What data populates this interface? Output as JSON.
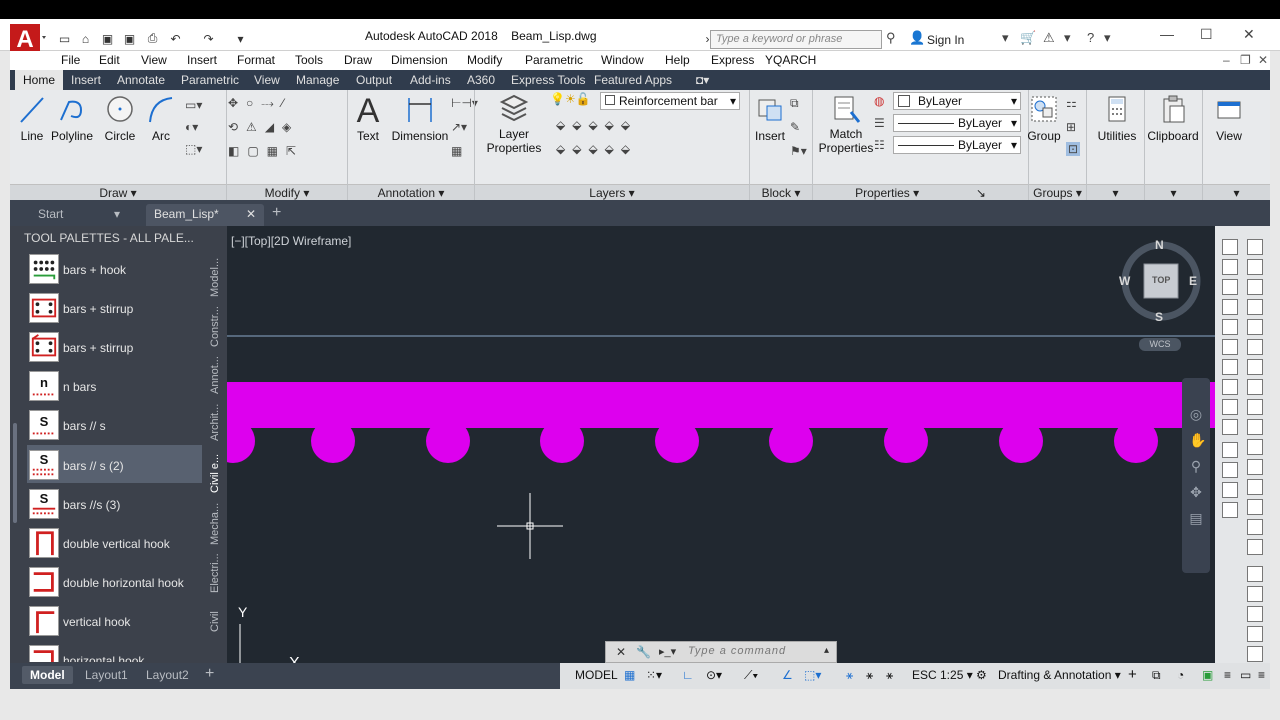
{
  "titlebar": {
    "app_title": "Autodesk AutoCAD 2018",
    "file_name": "Beam_Lisp.dwg",
    "search_placeholder": "Type a keyword or phrase",
    "sign_in": "Sign In"
  },
  "menu": [
    "File",
    "Edit",
    "View",
    "Insert",
    "Format",
    "Tools",
    "Draw",
    "Dimension",
    "Modify",
    "Parametric",
    "Window",
    "Help",
    "Express",
    "YQARCH"
  ],
  "ribbon_tabs": [
    "Home",
    "Insert",
    "Annotate",
    "Parametric",
    "View",
    "Manage",
    "Output",
    "Add-ins",
    "A360",
    "Express Tools",
    "Featured Apps"
  ],
  "ribbon": {
    "draw": {
      "line": "Line",
      "polyline": "Polyline",
      "circle": "Circle",
      "arc": "Arc",
      "panel": "Draw"
    },
    "modify": {
      "panel": "Modify"
    },
    "annotation": {
      "text": "Text",
      "dimension": "Dimension",
      "panel": "Annotation"
    },
    "layers": {
      "layer_properties_1": "Layer",
      "layer_properties_2": "Properties",
      "current_layer": "Reinforcement bar",
      "panel": "Layers"
    },
    "block": {
      "insert": "Insert",
      "panel": "Block"
    },
    "properties": {
      "match_1": "Match",
      "match_2": "Properties",
      "color": "ByLayer",
      "linetype": "ByLayer",
      "lineweight": "ByLayer",
      "panel": "Properties"
    },
    "groups": {
      "group": "Group",
      "panel": "Groups"
    },
    "utilities": "Utilities",
    "clipboard": "Clipboard",
    "view": "View"
  },
  "doc_tabs": {
    "start": "Start",
    "active": "Beam_Lisp*"
  },
  "palette": {
    "header": "TOOL PALETTES - ALL PALE...",
    "items": [
      {
        "label": "bars + hook",
        "icon": "bars-hook-icon"
      },
      {
        "label": "bars + stirrup",
        "icon": "bars-stirrup-icon"
      },
      {
        "label": "bars + stirrup",
        "icon": "bars-stirrup-2-icon"
      },
      {
        "label": "n bars",
        "icon": "n-bars-icon"
      },
      {
        "label": "bars // s",
        "icon": "bars-s-icon"
      },
      {
        "label": "bars // s  (2)",
        "icon": "bars-s-2-icon"
      },
      {
        "label": "bars //s  (3)",
        "icon": "bars-s-3-icon"
      },
      {
        "label": "double vertical hook",
        "icon": "double-vertical-hook-icon"
      },
      {
        "label": "double horizontal hook",
        "icon": "double-horizontal-hook-icon"
      },
      {
        "label": "vertical hook",
        "icon": "vertical-hook-icon"
      },
      {
        "label": "horizontal hook",
        "icon": "horizontal-hook-icon"
      }
    ],
    "side_tabs": [
      "Model...",
      "Constr...",
      "Annot...",
      "Archit...",
      "Civil e...",
      "Mecha...",
      "Electri...",
      "Civil"
    ]
  },
  "viewport": {
    "label": "[−][Top][2D Wireframe]",
    "compass": {
      "n": "N",
      "s": "S",
      "e": "E",
      "w": "W",
      "cube": "TOP",
      "ucs": "WCS"
    },
    "ucs_x": "X",
    "ucs_y": "Y"
  },
  "colors": {
    "beam": "#dd00ee",
    "canvas": "#212830",
    "line": "#8aa8c8",
    "accent": "#1d6fd0"
  },
  "command": {
    "placeholder": "Type a command"
  },
  "layout_tabs": [
    "Model",
    "Layout1",
    "Layout2"
  ],
  "status": {
    "model": "MODEL",
    "scale": "ESC 1:25",
    "workspace": "Drafting & Annotation"
  }
}
